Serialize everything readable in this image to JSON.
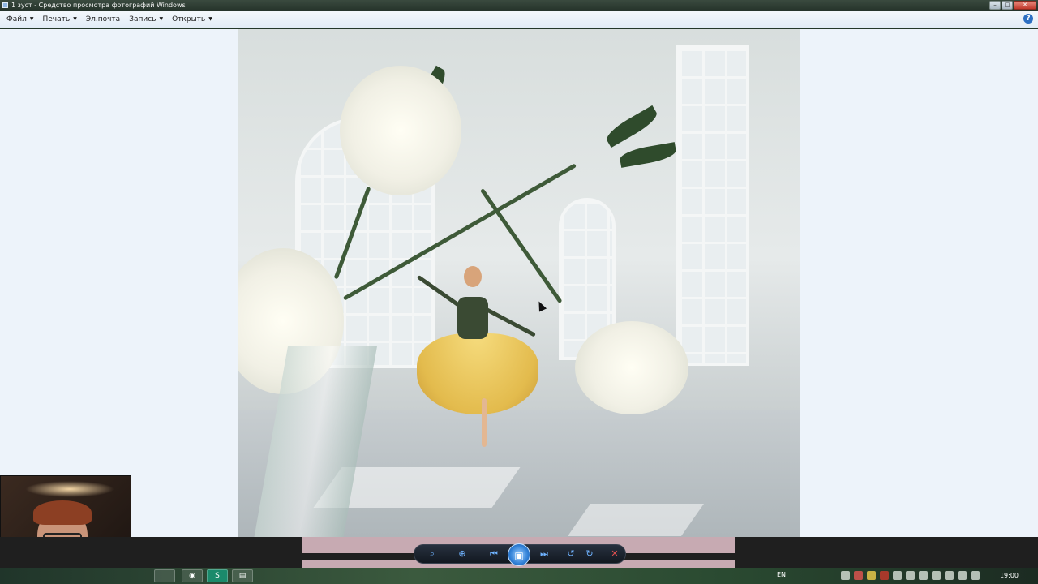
{
  "window": {
    "title": "1 зуст - Средство просмотра фотографий Windows",
    "controls": {
      "minimize": "–",
      "maximize": "□",
      "close": "✕"
    }
  },
  "menu": {
    "items": [
      {
        "label": "Файл"
      },
      {
        "label": "Печать"
      },
      {
        "label": "Эл.почта"
      },
      {
        "label": "Запись"
      },
      {
        "label": "Открыть"
      }
    ],
    "help_icon": "?"
  },
  "controls": {
    "zoom": "⌕",
    "fit": "⊕",
    "previous": "⏮",
    "slideshow": "▣",
    "next": "⏭",
    "rotate_ccw": "↺",
    "rotate_cw": "↻",
    "delete": "✕"
  },
  "taskbar": {
    "language": "EN",
    "clock": "19:00",
    "buttons": [
      {
        "glyph": ""
      },
      {
        "glyph": "◉"
      },
      {
        "glyph": "S"
      },
      {
        "glyph": "▤"
      }
    ]
  }
}
